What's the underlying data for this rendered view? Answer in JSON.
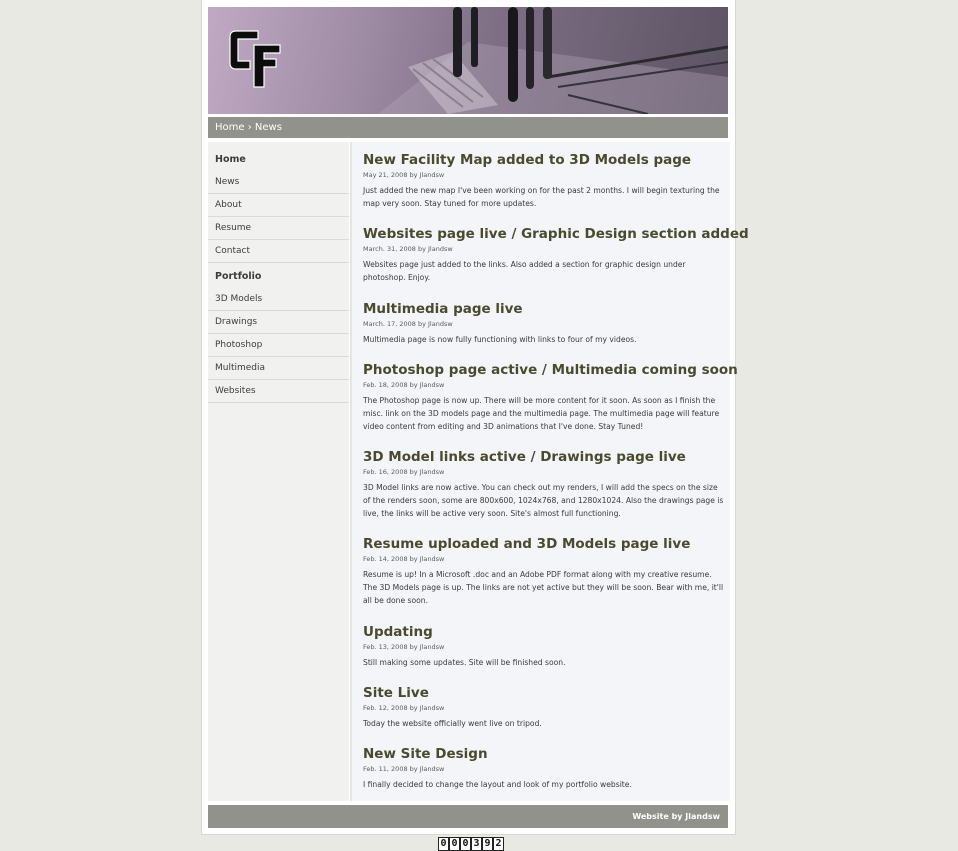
{
  "header": {
    "logo_alt": "CF logo"
  },
  "breadcrumb": {
    "text": "Home › News"
  },
  "sidebar": {
    "sections": [
      {
        "heading": "Home",
        "items": [
          "News",
          "About",
          "Resume",
          "Contact"
        ]
      },
      {
        "heading": "Portfolio",
        "items": [
          "3D Models",
          "Drawings",
          "Photoshop",
          "Multimedia",
          "Websites"
        ]
      }
    ]
  },
  "posts": [
    {
      "title": "New Facility Map added to 3D Models page",
      "meta": "May 21, 2008 by Jlandsw",
      "body": "Just added the new map I've been working on for the past 2 months. I will begin texturing the map very soon. Stay tuned for more updates."
    },
    {
      "title": "Websites page live / Graphic Design section added",
      "meta": "March. 31, 2008 by Jlandsw",
      "body": "Websites page just added to the links. Also added a section for graphic design under photoshop. Enjoy."
    },
    {
      "title": "Multimedia page live",
      "meta": "March. 17, 2008 by Jlandsw",
      "body": "Multimedia page is now fully functioning with links to four of my videos."
    },
    {
      "title": "Photoshop page active / Multimedia coming soon",
      "meta": "Feb. 18, 2008 by Jlandsw",
      "body": "The Photoshop page is now up. There will be more content for it soon. As soon as I finish the misc. link on the 3D models page and the multimedia page. The multimedia page will feature video content from editing and 3D animations that I've done. Stay Tuned!"
    },
    {
      "title": "3D Model links active / Drawings page live",
      "meta": "Feb. 16, 2008 by Jlandsw",
      "body": "3D Model links are now active. You can check out my renders, I will add the specs on the size of the renders soon, some are 800x600, 1024x768, and 1280x1024. Also the drawings page is live, the links will be active very soon. Site's almost full functioning."
    },
    {
      "title": "Resume uploaded and 3D Models page live",
      "meta": "Feb. 14, 2008 by Jlandsw",
      "body": "Resume is up! In a Microsoft .doc and an Adobe PDF format along with my creative resume. The 3D Models page is up. The links are not yet active but they will be soon. Bear with me, it'll all be done soon."
    },
    {
      "title": "Updating",
      "meta": "Feb. 13, 2008 by Jlandsw",
      "body": "Still making some updates. Site will be finished soon."
    },
    {
      "title": "Site Live",
      "meta": "Feb. 12, 2008 by Jlandsw",
      "body": "Today the website officially went live on tripod."
    },
    {
      "title": "New Site Design",
      "meta": "Feb. 11, 2008 by Jlandsw",
      "body": "I finally decided to change the layout and look of my portfolio website."
    }
  ],
  "footer": {
    "credit": "Website by Jlandsw"
  },
  "counter": {
    "digits": [
      "0",
      "0",
      "0",
      "3",
      "9",
      "2"
    ]
  },
  "colors": {
    "bar": "#92928c",
    "content_bg": "#f4f5f9",
    "sidebar_bg": "#f1f2f0",
    "title": "#4a4a2f"
  }
}
